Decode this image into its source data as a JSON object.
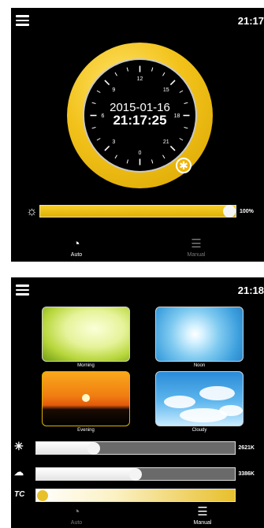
{
  "auto_screen": {
    "time": "21:17",
    "dial": {
      "date": "2015-01-16",
      "time": "21:17:25",
      "hour_labels": [
        "12",
        "15",
        "18",
        "21",
        "0",
        "3",
        "6",
        "9"
      ]
    },
    "brightness": {
      "value_label": "100%",
      "level_fraction": 1.0
    },
    "tabs": [
      {
        "label": "Auto",
        "icon": "clock-icon",
        "active": true
      },
      {
        "label": "Manual",
        "icon": "list-icon",
        "active": false
      }
    ]
  },
  "manual_screen": {
    "time": "21:18",
    "scenes": [
      {
        "label": "Morning",
        "selected": false
      },
      {
        "label": "Noon",
        "selected": false
      },
      {
        "label": "Evening",
        "selected": true
      },
      {
        "label": "Cloudy",
        "selected": false
      }
    ],
    "sliders": [
      {
        "icon": "sun-icon",
        "value_label": "2621K",
        "level_fraction": 0.29
      },
      {
        "icon": "cloud-icon",
        "value_label": "3386K",
        "level_fraction": 0.5
      },
      {
        "icon": "tc-icon",
        "icon_text": "TC",
        "value_label": "",
        "level_fraction": 0.02
      }
    ],
    "tabs": [
      {
        "label": "Auto",
        "icon": "clock-icon",
        "active": false
      },
      {
        "label": "Manual",
        "icon": "list-icon",
        "active": true
      }
    ]
  },
  "colors": {
    "accent": "#f2c21a",
    "background": "#000000"
  }
}
